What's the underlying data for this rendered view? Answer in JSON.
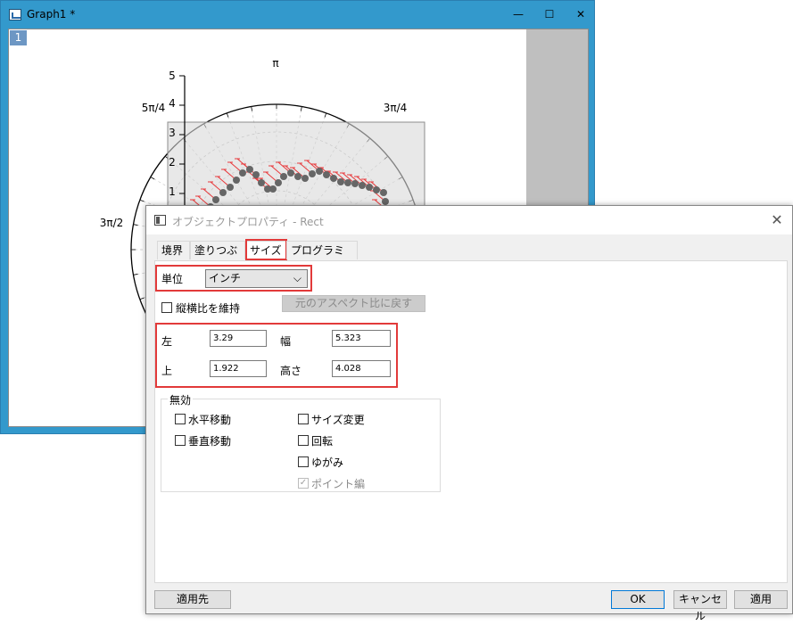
{
  "graph_window": {
    "title": "Graph1 *",
    "layer_number": "1",
    "controls": {
      "minimize": "—",
      "maximize": "☐",
      "close": "✕"
    },
    "polar": {
      "angle_labels": [
        "π",
        "3π/4",
        "5π/4",
        "3π/2"
      ],
      "radius_ticks": [
        "1",
        "2",
        "3",
        "4",
        "5"
      ]
    }
  },
  "dialog": {
    "title": "オブジェクトプロパティ - Rect",
    "close": "✕",
    "tabs": [
      "境界",
      "塗りつぶし",
      "サイズ",
      "プログラミング"
    ],
    "active_tab": "サイズ",
    "unit_label": "単位",
    "unit_value": "インチ",
    "keep_aspect_label": "縦横比を維持",
    "restore_aspect_button": "元のアスペクト比に戻す",
    "left_label": "左",
    "left_value": "3.29",
    "width_label": "幅",
    "width_value": "5.323",
    "top_label": "上",
    "top_value": "1.922",
    "height_label": "高さ",
    "height_value": "4.028",
    "disabled_group_label": "無効",
    "options": {
      "horizontal_move": "水平移動",
      "resize": "サイズ変更",
      "vertical_move": "垂直移動",
      "rotate": "回転",
      "skew": "ゆがみ",
      "point_edit": "ポイント編"
    },
    "buttons": {
      "apply_to": "適用先",
      "ok": "OK",
      "cancel": "キャンセル",
      "apply": "適用"
    }
  },
  "colors": {
    "window_frame": "#3399cc",
    "highlight": "#e23a3a",
    "error_bars": "#e8393b",
    "data_points": "#666666"
  }
}
